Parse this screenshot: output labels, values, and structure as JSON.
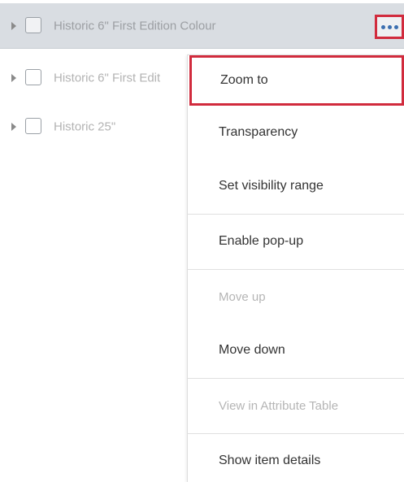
{
  "layers": [
    {
      "name": "Historic 6\" First Edition Colour",
      "selected": true
    },
    {
      "name": "Historic 6\" First Edit"
    },
    {
      "name": "Historic 25\""
    }
  ],
  "options_button": {
    "icon": "ellipsis-icon"
  },
  "menu": {
    "items": [
      {
        "label": "Zoom to",
        "state": "highlighted"
      },
      {
        "label": "Transparency",
        "state": "enabled"
      },
      {
        "label": "Set visibility range",
        "state": "enabled"
      },
      {
        "label": "Enable pop-up",
        "state": "enabled"
      },
      {
        "label": "Move up",
        "state": "disabled"
      },
      {
        "label": "Move down",
        "state": "enabled"
      },
      {
        "label": "View in Attribute Table",
        "state": "disabled"
      },
      {
        "label": "Show item details",
        "state": "enabled"
      }
    ]
  },
  "colors": {
    "highlight_border": "#d12b3d",
    "selected_row_bg": "#d9dde2",
    "options_dots": "#3b6fb0"
  }
}
